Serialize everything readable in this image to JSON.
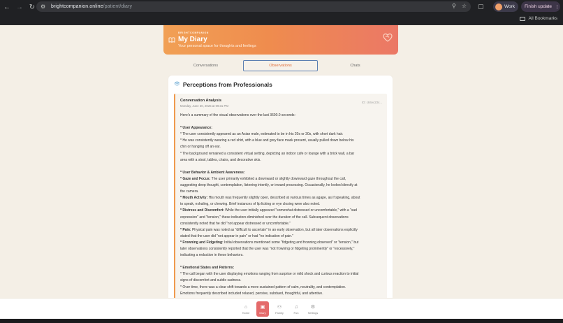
{
  "browser": {
    "url_host": "brightcompanion.online",
    "url_path": "/patient/diary",
    "profile_label": "Work",
    "update_label": "Finish update",
    "bookmarks_label": "All Bookmarks"
  },
  "banner": {
    "brand": "BRIGHTCOMPANION",
    "title": "My Diary",
    "subtitle": "Your personal space for thoughts and feelings"
  },
  "tabs": [
    {
      "label": "Conversations"
    },
    {
      "label": "Observations"
    },
    {
      "label": "Chats"
    }
  ],
  "section": {
    "title": "Perceptions from Professionals"
  },
  "entry": {
    "title": "Conversation Analysis",
    "date": "Monday, June 30, 2025 at 09:31 PM",
    "id": "ID: c84ec234...",
    "lines": [
      {
        "t": "Here's a summary of the visual observations over the last 3600.0 seconds:"
      },
      {
        "t": ""
      },
      {
        "h": "* User Appearance:"
      },
      {
        "t": "* The user consistently appeared as an Asian male, estimated to be in his 20s or 30s, with short dark hair."
      },
      {
        "t": "* He was consistently wearing a red shirt, with a blue and grey face mask present, usually pulled down below his"
      },
      {
        "t": "chin or hanging off an ear."
      },
      {
        "t": "* The background remained a consistent virtual setting, depicting an indoor cafe or lounge with a brick wall, a bar"
      },
      {
        "t": "area with a stool, tables, chairs, and decorative skis."
      },
      {
        "t": ""
      },
      {
        "h": "* User Behavior & Ambient Awareness:"
      },
      {
        "h": "* Gaze and Focus:",
        "t": " The user primarily exhibited a downward or slightly downward gaze throughout the call,"
      },
      {
        "t": "suggesting deep thought, contemplation, listening intently, or inward processing. Occasionally, he looked directly at"
      },
      {
        "t": "the camera."
      },
      {
        "h": "* Mouth Activity:",
        "t": " His mouth was frequently slightly open, described at various times as agape, as if speaking, about"
      },
      {
        "t": "to speak, exhaling, or chewing. Brief instances of lip licking or eye closing were also noted."
      },
      {
        "h": "* Distress and Discomfort:",
        "t": " While the user initially appeared \"somewhat distressed or uncomfortable,\" with a \"sad"
      },
      {
        "t": "expression\" and \"tension,\" these indicators diminished over the duration of the call. Subsequent observations"
      },
      {
        "t": "consistently noted that he did \"not appear distressed or uncomfortable.\""
      },
      {
        "h": "* Pain:",
        "t": " Physical pain was noted as \"difficult to ascertain\" in an early observation, but all later observations explicitly"
      },
      {
        "t": "stated that the user did \"not appear in pain\" or had \"no indication of pain.\""
      },
      {
        "h": "* Frowning and Fidgeting:",
        "t": " Initial observations mentioned some \"fidgeting and frowning observed\" or \"tension,\" but"
      },
      {
        "t": "later observations consistently reported that the user was \"not frowning or fidgeting prominently\" or \"excessively,\""
      },
      {
        "t": "indicating a reduction in these behaviors."
      },
      {
        "t": ""
      },
      {
        "h": "* Emotional States and Patterns:"
      },
      {
        "t": "* The call began with the user displaying emotions ranging from surprise or mild shock and curious reaction to initial"
      },
      {
        "t": "signs of discomfort and subtle sadness."
      },
      {
        "t": "* Over time, there was a clear shift towards a more sustained pattern of calm, neutrality, and contemplation."
      },
      {
        "t": "Emotions frequently described included relaxed, pensive, subdued, thoughtful, and attentive."
      }
    ]
  },
  "bottom_nav": [
    {
      "label": "Home",
      "icon": "home-icon"
    },
    {
      "label": "Diary",
      "icon": "book-icon"
    },
    {
      "label": "Family",
      "icon": "people-icon"
    },
    {
      "label": "Fun",
      "icon": "music-icon"
    },
    {
      "label": "Settings",
      "icon": "gear-icon"
    }
  ],
  "colors": {
    "accent": "#ef8c4e",
    "active_nav": "#e46a6a",
    "tab_border": "#5b7fb2"
  }
}
